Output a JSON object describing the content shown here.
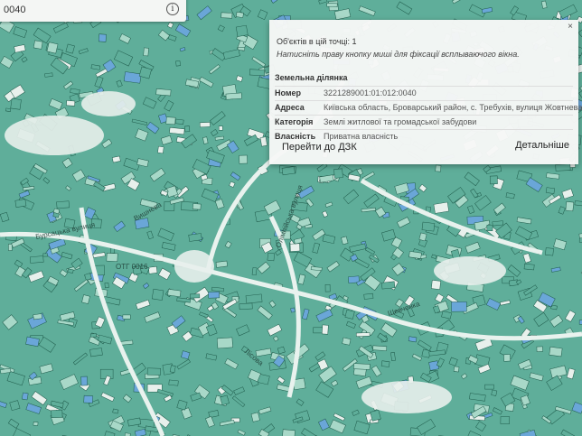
{
  "search": {
    "value": "0040",
    "info_icon": "info-icon"
  },
  "map": {
    "colors": {
      "green": "#5fae9a",
      "light": "#a8d8c8",
      "blue": "#6aa6d8",
      "white": "#e8f0ec",
      "line": "#1e5a4a"
    },
    "street_labels": [
      {
        "text": "Бурсацька вулиця",
        "name": "street-label-1"
      },
      {
        "text": "Олімпійська вулиця",
        "name": "street-label-2"
      },
      {
        "text": "Шевченка",
        "name": "street-label-3"
      },
      {
        "text": "Лісова",
        "name": "street-label-4"
      },
      {
        "text": "Вишнева",
        "name": "street-label-5"
      }
    ],
    "area_label": "ОТГ 0016"
  },
  "popup": {
    "close_label": "×",
    "count": "Об'єктів в цій точці: 1",
    "hint": "Натисніть праву кнопку миші для фіксації всплываючого вікна.",
    "section_title": "Земельна ділянка",
    "rows": [
      {
        "key": "Номер",
        "value": "3221289001:01:012:0040"
      },
      {
        "key": "Адреса",
        "value": "Київська область, Броварський район, с. Требухів, вулиця Жовтнева"
      },
      {
        "key": "Категорія",
        "value": "Землі житлової та громадської забудови"
      },
      {
        "key": "Власність",
        "value": "Приватна власність"
      }
    ],
    "link_dzk": "Перейти до ДЗК",
    "link_details": "Детальніше"
  }
}
